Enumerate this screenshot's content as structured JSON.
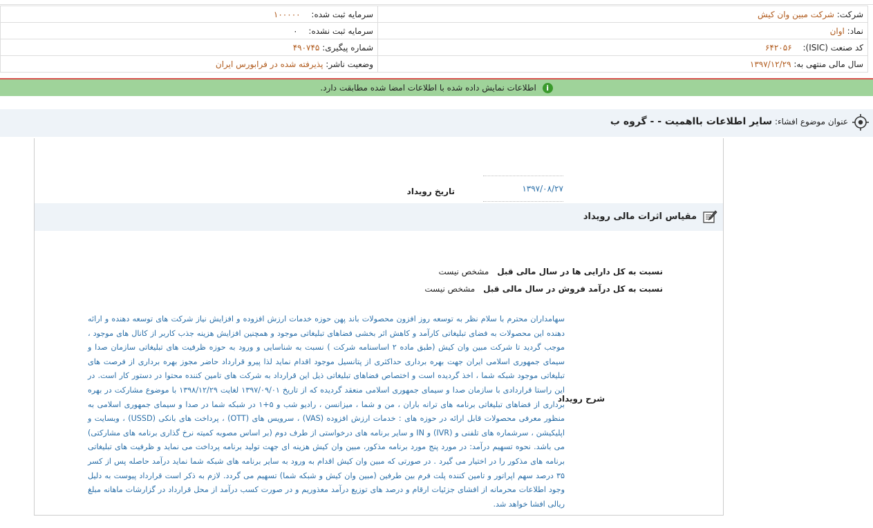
{
  "header": {
    "rows": [
      {
        "right_label": "شرکت:",
        "right_value": "شرکت مبین وان کیش",
        "left_label": "سرمایه ثبت شده:",
        "left_value": "۱۰۰۰۰۰"
      },
      {
        "right_label": "نماد:",
        "right_value": "اوان",
        "left_label": "سرمایه ثبت نشده:",
        "left_value": "۰"
      },
      {
        "right_label": "کد صنعت (ISIC):",
        "right_value": "۶۴۲۰۵۶",
        "left_label": "شماره پیگیری:",
        "left_value": "۴۹۰۷۴۵"
      },
      {
        "right_label": "سال مالی منتهی به:",
        "right_value": "۱۳۹۷/۱۲/۲۹",
        "left_label": "وضعیت ناشر:",
        "left_value": "پذیرفته شده در فرابورس ایران"
      }
    ]
  },
  "notice": {
    "text": "اطلاعات نمایش داده شده با اطلاعات امضا شده مطابقت دارد.",
    "icon": "info-icon"
  },
  "subject": {
    "label": "عنوان موضوع افشاء:",
    "title": "سایر اطلاعات بااهمیت - - گروه ب",
    "icon": "target-icon"
  },
  "event": {
    "date_label": "تاریخ رویداد",
    "date_value": "۱۳۹۷/۰۸/۲۷"
  },
  "section": {
    "title": "مقیاس اثرات مالی رویداد",
    "icon": "edit-icon"
  },
  "ratios": [
    {
      "label": "نسبت به کل دارایی ها در سال مالی قبل",
      "value": "مشخص نیست"
    },
    {
      "label": "نسبت به کل درآمد فروش در سال مالی قبل",
      "value": "مشخص نیست"
    }
  ],
  "description": {
    "label": "شرح رویداد",
    "text": "سهامداران محترم با سلام نظر به توسعه روز افزون محصولات باند پهن حوزه خدمات ارزش افزوده و افزایش نیاز شرکت های توسعه دهنده و ارائه دهنده این محصولات به فضای تبلیغاتی کارآمد و کاهش اثر بخشی فضاهای تبلیغاتی موجود و همچنین افزایش هزینه جذب کاربر از کانال های موجود ، موجب گردید تا شرکت مبین وان کیش (طبق ماده ۲ اساسنامه شرکت ) نسبت به شناسایی و ورود به حوزه ظرفیت های تبلیغاتی سازمان صدا و سیمای جمهوری اسلامی ایران جهت بهره برداری حداکثری از پتانسیل موجود اقدام نماید لذا پیرو قرارداد حاضر مجوز بهره برداری از فرصت های تبلیغاتی موجود شبکه شما ، اخذ گردیده است و اختصاص فضاهای تبلیغاتی ذیل این قرارداد به شرکت های تامین کننده محتوا در دستور کار است. در این راستا قراردادی با سازمان صدا و سیمای جمهوری اسلامی منعقد گردیده که از تاریخ ۱۳۹۷/۰۹/۰۱ لغایت ۱۳۹۸/۱۲/۲۹ با موضوع مشارکت در بهره برداری از فضاهای تبلیغاتی برنامه های ترانه باران ، من و شما ، میزانسن ، رادیو شب و ۵+۱ در شبکه شما در صدا و سیمای جمهوری اسلامی به منظور معرفی محصولات قابل ارائه در حوزه های : خدمات ارزش افزوده (VAS) ، سرویس های (OTT) ، پرداخت های بانکی (USSD) ، وبسایت و اپلیکیشن ، سرشماره های تلفنی و (IVR) و IN و سایر برنامه های درخواستی از طرف دوم (بر اساس مصوبه کمیته نرخ گذاری برنامه های مشارکتی) می باشد. نحوه تسهیم درآمد: در مورد پنج مورد برنامه مذکور، مبین وان کیش هزینه ای جهت تولید برنامه پرداخت می نماید و ظرفیت های تبلیغاتی برنامه های مذکور را در اختیار می گیرد . در صورتی که مبین وان کیش اقدام به ورود به سایر برنامه های شبکه شما نماید درآمد حاصله پس از کسر ۳۵ درصد سهم اپراتور و تامین کننده پلت فرم بین طرفین (مبین وان کیش و شبکه شما) تسهیم می گردد. لازم به ذکر است قرارداد پیوست به دلیل وجود اطلاعات محرمانه از افشای جزئیات ارقام و درصد های توزیع درآمد معذوریم و در صورت کسب درآمد از محل قرارداد در گزارشات ماهانه مبلغ ریالی افشا خواهد شد."
  }
}
